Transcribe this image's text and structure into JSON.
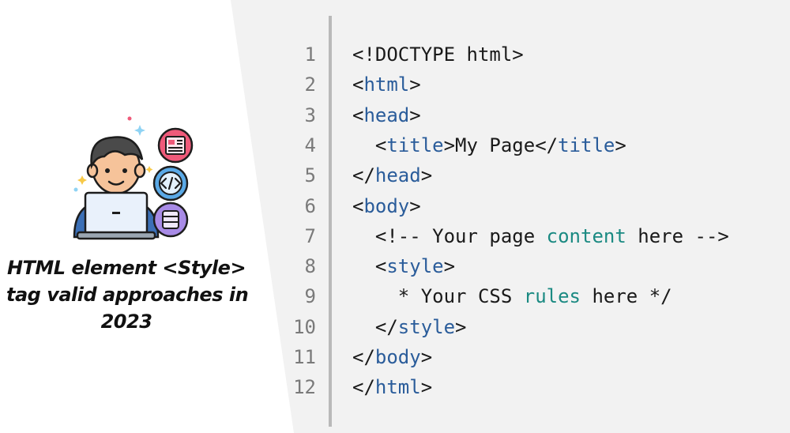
{
  "headline": {
    "line1": "HTML element <Style>",
    "line2": "tag valid approaches in",
    "line3": "2023"
  },
  "code": {
    "lines": [
      {
        "num": "1",
        "tokens": [
          {
            "t": "<!DOCTYPE html>",
            "c": "plain"
          }
        ]
      },
      {
        "num": "2",
        "tokens": [
          {
            "t": "<",
            "c": "plain"
          },
          {
            "t": "html",
            "c": "tag"
          },
          {
            "t": ">",
            "c": "plain"
          }
        ]
      },
      {
        "num": "3",
        "tokens": [
          {
            "t": "<",
            "c": "plain"
          },
          {
            "t": "head",
            "c": "tag"
          },
          {
            "t": ">",
            "c": "plain"
          }
        ]
      },
      {
        "num": "4",
        "tokens": [
          {
            "t": "  <",
            "c": "plain"
          },
          {
            "t": "title",
            "c": "tag"
          },
          {
            "t": ">My Page</",
            "c": "plain"
          },
          {
            "t": "title",
            "c": "tag"
          },
          {
            "t": ">",
            "c": "plain"
          }
        ]
      },
      {
        "num": "5",
        "tokens": [
          {
            "t": "</",
            "c": "plain"
          },
          {
            "t": "head",
            "c": "tag"
          },
          {
            "t": ">",
            "c": "plain"
          }
        ]
      },
      {
        "num": "6",
        "tokens": [
          {
            "t": "<",
            "c": "plain"
          },
          {
            "t": "body",
            "c": "tag"
          },
          {
            "t": ">",
            "c": "plain"
          }
        ]
      },
      {
        "num": "7",
        "tokens": [
          {
            "t": "  <!-- Your page ",
            "c": "plain"
          },
          {
            "t": "content",
            "c": "kw"
          },
          {
            "t": " here -->",
            "c": "plain"
          }
        ]
      },
      {
        "num": "8",
        "tokens": [
          {
            "t": "  <",
            "c": "plain"
          },
          {
            "t": "style",
            "c": "tag"
          },
          {
            "t": ">",
            "c": "plain"
          }
        ]
      },
      {
        "num": "9",
        "tokens": [
          {
            "t": "    * Your CSS ",
            "c": "plain"
          },
          {
            "t": "rules",
            "c": "kw"
          },
          {
            "t": " here */",
            "c": "plain"
          }
        ]
      },
      {
        "num": "10",
        "tokens": [
          {
            "t": "  </",
            "c": "plain"
          },
          {
            "t": "style",
            "c": "tag"
          },
          {
            "t": ">",
            "c": "plain"
          }
        ]
      },
      {
        "num": "11",
        "tokens": [
          {
            "t": "</",
            "c": "plain"
          },
          {
            "t": "body",
            "c": "tag"
          },
          {
            "t": ">",
            "c": "plain"
          }
        ]
      },
      {
        "num": "12",
        "tokens": [
          {
            "t": "</",
            "c": "plain"
          },
          {
            "t": "html",
            "c": "tag"
          },
          {
            "t": ">",
            "c": "plain"
          }
        ]
      }
    ]
  },
  "colors": {
    "tag": "#2a5c9a",
    "keyword": "#1b8a82",
    "plain": "#1a1a1a",
    "line_number": "#7a7a7a",
    "code_background": "#f2f2f2"
  },
  "icons": [
    "developer-avatar-icon",
    "laptop-icon",
    "layout-icon",
    "code-icon",
    "list-icon",
    "sparkle-icon"
  ]
}
